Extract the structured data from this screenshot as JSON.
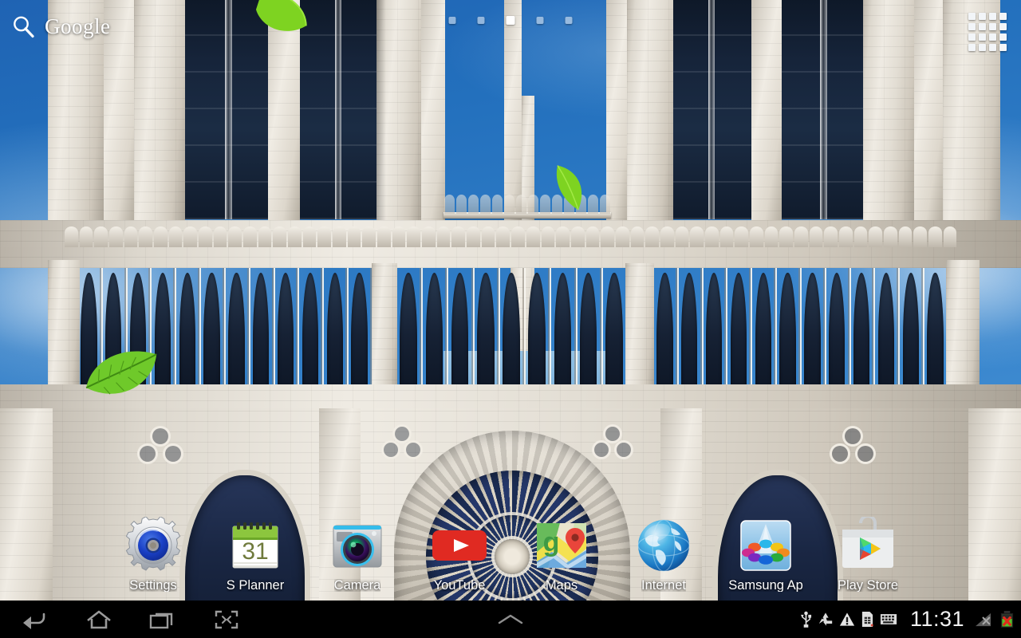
{
  "device": {
    "platform": "Android tablet home screen",
    "wallpaper_subject": "Notre Dame cathedral facade with blue sky and falling green leaves"
  },
  "search": {
    "icon": "search-icon",
    "brand": "Google"
  },
  "page_indicator": {
    "count": 5,
    "active_index": 2
  },
  "apps_drawer": {
    "icon": "apps-grid-icon",
    "label": "Apps"
  },
  "home_apps": [
    {
      "label": "Settings",
      "icon": "settings-gear-icon"
    },
    {
      "label": "S Planner",
      "icon": "calendar-icon",
      "badge": "31"
    },
    {
      "label": "Camera",
      "icon": "camera-icon"
    },
    {
      "label": "YouTube",
      "icon": "youtube-icon"
    },
    {
      "label": "Maps",
      "icon": "google-maps-icon"
    },
    {
      "label": "Internet",
      "icon": "globe-browser-icon"
    },
    {
      "label": "Samsung Ap",
      "icon": "samsung-apps-icon"
    },
    {
      "label": "Play Store",
      "icon": "play-store-icon"
    }
  ],
  "navbar": {
    "buttons": [
      {
        "name": "back-button",
        "icon": "back-arrow-icon"
      },
      {
        "name": "home-button",
        "icon": "home-icon"
      },
      {
        "name": "recents-button",
        "icon": "recent-apps-icon"
      },
      {
        "name": "screenshot-button",
        "icon": "screen-capture-icon"
      }
    ],
    "expand": {
      "name": "expand-handle",
      "icon": "chevron-up-icon"
    }
  },
  "status_bar": {
    "icons": [
      "usb-icon",
      "recycle-icon",
      "warning-triangle-icon",
      "sim-card-icon",
      "keyboard-icon"
    ],
    "time": "11:31",
    "signal": {
      "icon": "no-signal-icon",
      "state": "no service"
    },
    "battery": {
      "icon": "battery-error-icon",
      "state": "not charging"
    }
  },
  "colors": {
    "sky_blue": "#2f7cc6",
    "stone": "#e2ddd3",
    "youtube_red": "#e12b23",
    "calendar_green": "#8cc63e",
    "settings_blue": "#1440c8",
    "navbar_black": "#000000",
    "accent_white": "#ffffff"
  }
}
